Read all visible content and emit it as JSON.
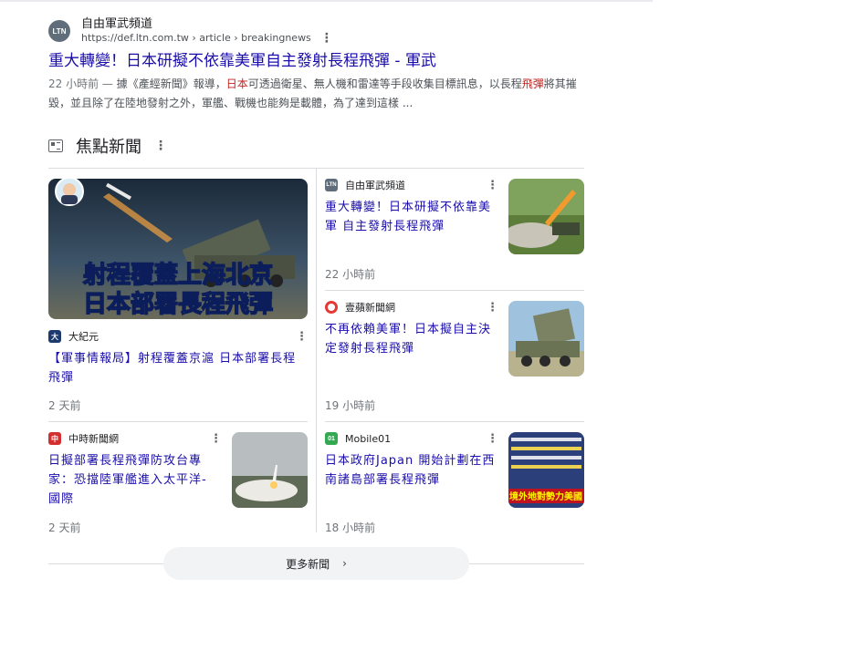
{
  "result": {
    "logo_text": "LTN",
    "site_name": "自由軍武頻道",
    "url": "https://def.ltn.com.tw › article › breakingnews",
    "title": "重大轉變！日本研擬不依靠美軍自主發射長程飛彈 - 軍武",
    "snippet_age": "22 小時前 — ",
    "snippet_a": "據《產經新聞》報導，",
    "snippet_hl1": "日本",
    "snippet_b": "可透過衛星、無人機和雷達等手段收集目標訊息，以長程",
    "snippet_hl2": "飛彈",
    "snippet_c": "將其摧毀，並且除了在陸地發射之外，軍艦、戰機也能夠是載體，為了達到這樣 ..."
  },
  "top_stories": {
    "title": "焦點新聞",
    "cards": [
      {
        "source": "大紀元",
        "fav_text": "大",
        "fav_color": "#1d3a6e",
        "title": "【軍事情報局】射程覆蓋京滬 日本部署長程飛彈",
        "age": "2 天前",
        "image_caption_1": "射程覆蓋上海北京",
        "image_caption_2": "日本部署長程飛彈"
      },
      {
        "source": "自由軍武頻道",
        "fav_text": "LTN",
        "fav_color": "#5f6e7a",
        "title": "重大轉變！日本研擬不依靠美軍 自主發射長程飛彈",
        "age": "22 小時前"
      },
      {
        "source": "壹蘋新聞網",
        "fav_text": "",
        "fav_color": "#e53935",
        "title": "不再依賴美軍！日本擬自主決定發射長程飛彈",
        "age": "19 小時前"
      },
      {
        "source": "中時新聞網",
        "fav_text": "中",
        "fav_color": "#d32f2f",
        "title": "日擬部署長程飛彈防攻台專家：恐擋陸軍艦進入太平洋-國際",
        "age": "2 天前"
      },
      {
        "source": "Mobile01",
        "fav_text": "01",
        "fav_color": "#34a853",
        "title": "日本政府Japan 開始計劃在西南諸島部署長程飛彈",
        "age": "18 小時前",
        "thumb_banner": "境外地對勢力美國"
      }
    ],
    "more_label": "更多新聞",
    "more_icon": "chevron-right-icon"
  },
  "kebab_icon": "⋮",
  "chevron_glyph": "›"
}
